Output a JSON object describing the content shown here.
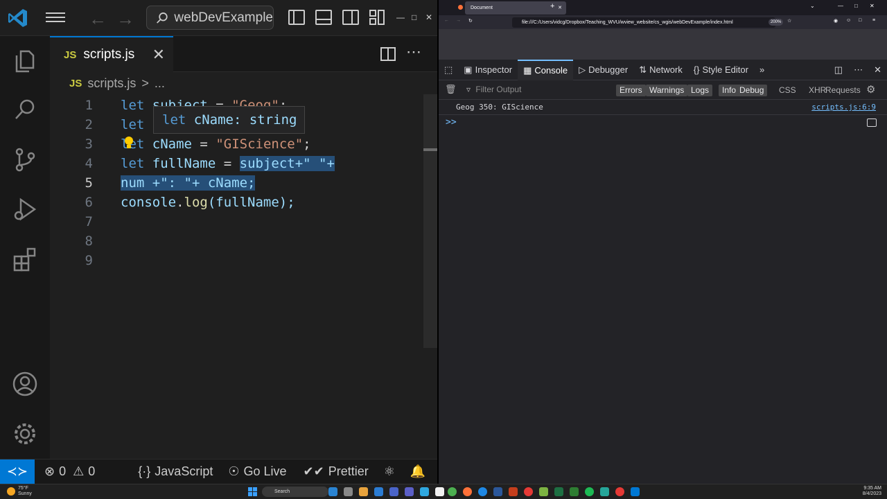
{
  "vscode": {
    "search_text": "webDevExample",
    "tab_name": "scripts.js",
    "tab_badge": "JS",
    "breadcrumb_file": "scripts.js",
    "breadcrumb_more": "...",
    "breadcrumb_sep": ">",
    "code_lines": [
      {
        "num": "1",
        "kw": "let",
        "name": "subject",
        "eq": " = ",
        "val": "\"Geog\"",
        "end": ";"
      },
      {
        "num": "2",
        "kw": "let",
        "name": "",
        "eq": "",
        "val": "",
        "end": ""
      },
      {
        "num": "3",
        "kw": "let",
        "name": "cName",
        "eq": " = ",
        "val": "\"GIScience\"",
        "end": ";"
      },
      {
        "num": "4",
        "kw": "let",
        "name": "fullName",
        "eq": " = ",
        "sel": "subject+\" \"+",
        "end": ""
      },
      {
        "num": "5",
        "sel": "num +\": \"+ cName;"
      },
      {
        "num": "6",
        "obj": "console",
        "dot": ".",
        "fn": "log",
        "arg": "(fullName);"
      },
      {
        "num": "7"
      },
      {
        "num": "8"
      },
      {
        "num": "9"
      }
    ],
    "hover": {
      "kw": "let",
      "text": "cName: string"
    },
    "status": {
      "errors": "0",
      "warnings": "0",
      "language": "JavaScript",
      "golive": "Go Live",
      "prettier": "Prettier"
    }
  },
  "firefox": {
    "tab_title": "Document",
    "url": "file:///C:/Users/vidcg/Dropbox/Teaching_WVU/wview_website/cs_wgis/webDevExample/index.html",
    "zoom": "200%",
    "devtools_tabs": [
      "Inspector",
      "Console",
      "Debugger",
      "Network",
      "Style Editor"
    ],
    "filter_placeholder": "Filter Output",
    "filters": [
      "Errors",
      "Warnings",
      "Logs",
      "Info",
      "Debug"
    ],
    "filters2": [
      "CSS",
      "XHR",
      "Requests"
    ],
    "log": {
      "text": "Geog 350: GIScience",
      "source": "scripts.js:6:9"
    },
    "prompt": ">>"
  },
  "taskbar": {
    "weather_temp": "75°F",
    "weather_desc": "Sunny",
    "search": "Search",
    "time": "9:35 AM",
    "date": "8/4/2023"
  },
  "colors": {
    "accent": "#0078d4",
    "keyword": "#569cd6",
    "string": "#ce9178",
    "variable": "#9cdcfe",
    "selection": "#264f78"
  }
}
